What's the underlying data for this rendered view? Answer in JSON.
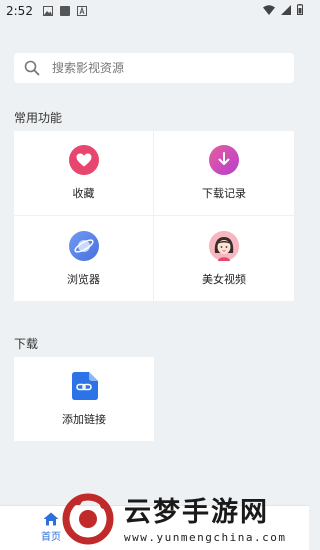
{
  "status_bar": {
    "time": "2:52"
  },
  "search": {
    "placeholder": "搜索影视资源"
  },
  "sections": {
    "common_title": "常用功能",
    "download_title": "下载"
  },
  "features": [
    {
      "label": "收藏",
      "icon": "heart-icon",
      "color": "#e8466e"
    },
    {
      "label": "下载记录",
      "icon": "download-icon",
      "color": "#d04fb8"
    },
    {
      "label": "浏览器",
      "icon": "planet-icon",
      "color": "#5b86e8"
    },
    {
      "label": "美女视频",
      "icon": "girl-avatar-icon",
      "color": "#f07b8a"
    }
  ],
  "download": {
    "label": "添加链接",
    "icon": "link-icon",
    "color": "#2d73e8"
  },
  "bottom_nav": {
    "home_label": "首页"
  },
  "watermark": {
    "cn": "云梦手游网",
    "en": "www.yunmengchina.com"
  },
  "colors": {
    "accent": "#2f6fdb",
    "background": "#eef1f3"
  }
}
